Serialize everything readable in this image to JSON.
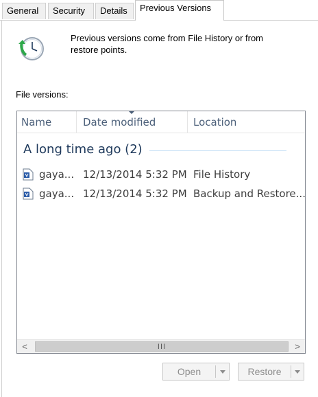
{
  "tabs": [
    {
      "label": "General"
    },
    {
      "label": "Security"
    },
    {
      "label": "Details"
    },
    {
      "label": "Previous Versions"
    }
  ],
  "icons": {
    "header": "history-clock-icon",
    "file": "document-icon"
  },
  "description": "Previous versions come from File History or from restore points.",
  "file_versions_label": "File versions:",
  "columns": {
    "name": "Name",
    "date": "Date modified",
    "location": "Location"
  },
  "group": {
    "label": "A long time ago (2)"
  },
  "rows": [
    {
      "name": "gaya...",
      "date": "12/13/2014 5:32 PM",
      "location": "File History"
    },
    {
      "name": "gaya...",
      "date": "12/13/2014 5:32 PM",
      "location": "Backup and Restore..."
    }
  ],
  "scrollbar": {
    "left": "<",
    "right": ">",
    "grip": "III"
  },
  "buttons": {
    "open": "Open",
    "restore": "Restore"
  },
  "colors": {
    "accent": "#1e395b",
    "header_text": "#4c607a",
    "disabled": "#8c8c8c"
  }
}
